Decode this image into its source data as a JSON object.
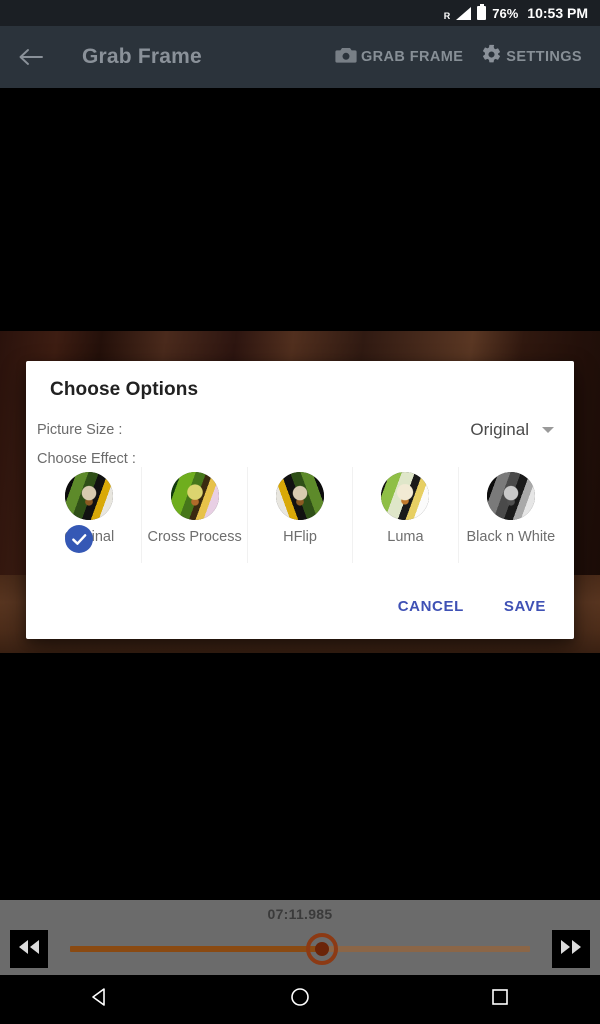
{
  "status_bar": {
    "roaming_label": "R",
    "battery_percent": "76%",
    "time": "10:53 PM",
    "icons": [
      "signal-icon",
      "battery-icon"
    ]
  },
  "app_bar": {
    "back_icon": "back-arrow-icon",
    "title": "Grab Frame",
    "actions": [
      {
        "icon": "camera-icon",
        "label": "GRAB FRAME"
      },
      {
        "icon": "gear-icon",
        "label": "SETTINGS"
      }
    ],
    "background_color": "#2b333b",
    "text_color": "#8a9199"
  },
  "dialog": {
    "title": "Choose Options",
    "picture_size": {
      "label": "Picture Size :",
      "value": "Original",
      "caret_icon": "chevron-down-icon"
    },
    "effects": {
      "label": "Choose Effect :",
      "selected": "Original",
      "check_icon": "check-circle-icon",
      "accent_color": "#3558b5",
      "items": [
        {
          "name": "Original",
          "style": "img-orig",
          "selected": true
        },
        {
          "name": "Cross Process",
          "style": "img-cross",
          "selected": false
        },
        {
          "name": "HFlip",
          "style": "img-hflip",
          "selected": false
        },
        {
          "name": "Luma",
          "style": "img-luma",
          "selected": false
        },
        {
          "name": "Black n White",
          "style": "img-bw",
          "selected": false
        }
      ]
    },
    "buttons": {
      "cancel": "CANCEL",
      "save": "SAVE",
      "color": "#3f51b5"
    }
  },
  "player": {
    "timestamp": "07:11.985",
    "prev_icon": "rewind-icon",
    "next_icon": "fast-forward-icon",
    "seek_progress_percent": 52.5,
    "track_color": "#8b6647",
    "fill_color": "#8a4a12",
    "thumb_color": "#8c3a14",
    "bar_background": "#6b6b6b"
  },
  "nav_bar": {
    "back_icon": "nav-back-icon",
    "home_icon": "nav-home-icon",
    "recents_icon": "nav-recents-icon"
  }
}
